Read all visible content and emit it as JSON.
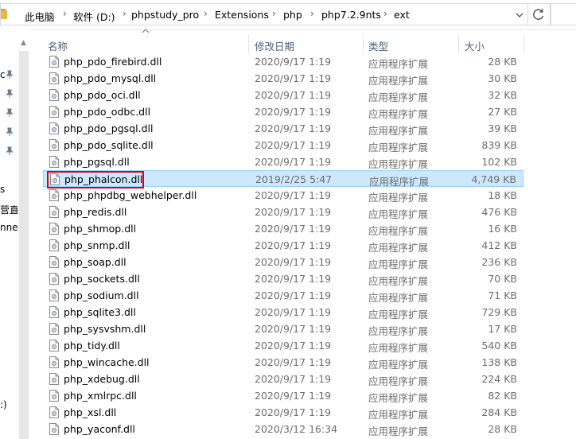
{
  "address_bar": {
    "crumbs": [
      "此电脑",
      "软件 (D:)",
      "phpstudy_pro",
      "Extensions",
      "php",
      "php7.2.9nts",
      "ext"
    ],
    "separator": "›",
    "refresh_icon": "refresh-icon",
    "dropdown_icon": "chevron-down-icon"
  },
  "nav_pane": {
    "fragments": [
      "c",
      "s",
      "营直",
      "nne",
      ":)"
    ],
    "pin_icon": "pin-icon"
  },
  "columns": {
    "name": "名称",
    "date": "修改日期",
    "type": "类型",
    "size": "大小"
  },
  "files": [
    {
      "name": "php_pdo_firebird.dll",
      "date": "2020/9/17 1:19",
      "type": "应用程序扩展",
      "size": "28 KB"
    },
    {
      "name": "php_pdo_mysql.dll",
      "date": "2020/9/17 1:19",
      "type": "应用程序扩展",
      "size": "30 KB"
    },
    {
      "name": "php_pdo_oci.dll",
      "date": "2020/9/17 1:19",
      "type": "应用程序扩展",
      "size": "32 KB"
    },
    {
      "name": "php_pdo_odbc.dll",
      "date": "2020/9/17 1:19",
      "type": "应用程序扩展",
      "size": "27 KB"
    },
    {
      "name": "php_pdo_pgsql.dll",
      "date": "2020/9/17 1:19",
      "type": "应用程序扩展",
      "size": "39 KB"
    },
    {
      "name": "php_pdo_sqlite.dll",
      "date": "2020/9/17 1:19",
      "type": "应用程序扩展",
      "size": "839 KB"
    },
    {
      "name": "php_pgsql.dll",
      "date": "2020/9/17 1:19",
      "type": "应用程序扩展",
      "size": "102 KB"
    },
    {
      "name": "php_phalcon.dll",
      "date": "2019/2/25 5:47",
      "type": "应用程序扩展",
      "size": "4,749 KB"
    },
    {
      "name": "php_phpdbg_webhelper.dll",
      "date": "2020/9/17 1:19",
      "type": "应用程序扩展",
      "size": "18 KB"
    },
    {
      "name": "php_redis.dll",
      "date": "2020/9/17 1:19",
      "type": "应用程序扩展",
      "size": "476 KB"
    },
    {
      "name": "php_shmop.dll",
      "date": "2020/9/17 1:19",
      "type": "应用程序扩展",
      "size": "16 KB"
    },
    {
      "name": "php_snmp.dll",
      "date": "2020/9/17 1:19",
      "type": "应用程序扩展",
      "size": "412 KB"
    },
    {
      "name": "php_soap.dll",
      "date": "2020/9/17 1:19",
      "type": "应用程序扩展",
      "size": "236 KB"
    },
    {
      "name": "php_sockets.dll",
      "date": "2020/9/17 1:19",
      "type": "应用程序扩展",
      "size": "70 KB"
    },
    {
      "name": "php_sodium.dll",
      "date": "2020/9/17 1:19",
      "type": "应用程序扩展",
      "size": "71 KB"
    },
    {
      "name": "php_sqlite3.dll",
      "date": "2020/9/17 1:19",
      "type": "应用程序扩展",
      "size": "729 KB"
    },
    {
      "name": "php_sysvshm.dll",
      "date": "2020/9/17 1:19",
      "type": "应用程序扩展",
      "size": "17 KB"
    },
    {
      "name": "php_tidy.dll",
      "date": "2020/9/17 1:19",
      "type": "应用程序扩展",
      "size": "540 KB"
    },
    {
      "name": "php_wincache.dll",
      "date": "2020/9/17 1:19",
      "type": "应用程序扩展",
      "size": "138 KB"
    },
    {
      "name": "php_xdebug.dll",
      "date": "2020/9/17 1:19",
      "type": "应用程序扩展",
      "size": "224 KB"
    },
    {
      "name": "php_xmlrpc.dll",
      "date": "2020/9/17 1:19",
      "type": "应用程序扩展",
      "size": "82 KB"
    },
    {
      "name": "php_xsl.dll",
      "date": "2020/9/17 1:19",
      "type": "应用程序扩展",
      "size": "284 KB"
    },
    {
      "name": "php_yaconf.dll",
      "date": "2020/3/12 16:34",
      "type": "应用程序扩展",
      "size": "28 KB"
    }
  ],
  "selected_index": 7,
  "file_icon": "dll-file-icon",
  "colors": {
    "selection_bg": "#cce8ff",
    "selection_border": "#99d1ff",
    "annotation_box": "#e00000",
    "header_text": "#4c607a"
  }
}
